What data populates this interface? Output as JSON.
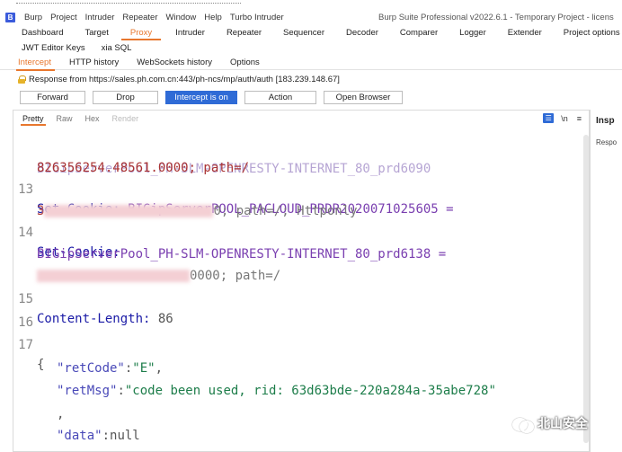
{
  "menubar": {
    "logo_letter": "B",
    "items": [
      "Burp",
      "Project",
      "Intruder",
      "Repeater",
      "Window",
      "Help",
      "Turbo Intruder"
    ],
    "title": "Burp Suite Professional v2022.6.1 - Temporary Project - licens"
  },
  "main_tabs": {
    "row1": [
      "Dashboard",
      "Target",
      "Proxy",
      "Intruder",
      "Repeater",
      "Sequencer",
      "Decoder",
      "Comparer",
      "Logger",
      "Extender",
      "Project options"
    ],
    "row2": [
      "JWT Editor Keys",
      "xia SQL"
    ],
    "active": "Proxy"
  },
  "proxy_tabs": {
    "items": [
      "Intercept",
      "HTTP history",
      "WebSockets history",
      "Options"
    ],
    "active": "Intercept"
  },
  "response_info": "Response from https://sales.ph.com.cn:443/ph-ncs/mp/auth/auth  [183.239.148.67]",
  "buttons": {
    "forward": "Forward",
    "drop": "Drop",
    "intercept": "Intercept is on",
    "action": "Action",
    "open_browser": "Open Browser"
  },
  "editor_tabs": {
    "items": [
      "Pretty",
      "Raw",
      "Hex",
      "Render"
    ],
    "active": "Pretty",
    "disabled": "Render",
    "newline_toggle": "\\n",
    "menu_icon": "≡"
  },
  "code_lines": [
    {
      "num": "",
      "text": "826356254.48561.0000; path=/"
    },
    {
      "num": "13",
      "key": "Set-Cookie:",
      "text": " BIGipServerPOOL_PACLOUD_PRDR2020071025605 ="
    },
    {
      "num": "",
      "prefix": "3",
      "text": "0; path=/; Httponly"
    },
    {
      "num": "14",
      "key": "Set-Cookie:",
      "text": ""
    },
    {
      "num": "",
      "text": "BIGipServerPool_PH-SLM-OPENRESTY-INTERNET_80_prd6138 ="
    },
    {
      "num": "",
      "text": "0000; path=/"
    },
    {
      "num": "15",
      "key": "Content-Length:",
      "text": " 86"
    },
    {
      "num": "16",
      "text": ""
    },
    {
      "num": "17",
      "text": "{"
    },
    {
      "num": "",
      "json_key": "\"retCode\"",
      "json_val": "\"E\"",
      "trail": ","
    },
    {
      "num": "",
      "json_key": "\"retMsg\"",
      "json_val": "\"code been used, rid: 63d63bde-220a284a-35abe728\"",
      "trail": ""
    },
    {
      "num": "",
      "text": ","
    },
    {
      "num": "",
      "json_key": "\"data\"",
      "json_plain": "null",
      "trail": ""
    },
    {
      "num": "",
      "text": "}"
    }
  ],
  "inspector": {
    "title": "Insp",
    "sub": "Respo"
  },
  "watermark": "北山安全",
  "colors": {
    "accent_orange": "#e8772e",
    "button_blue": "#2f6bd6",
    "header_blue": "#1a1aa6",
    "json_green": "#1d7d4a"
  }
}
